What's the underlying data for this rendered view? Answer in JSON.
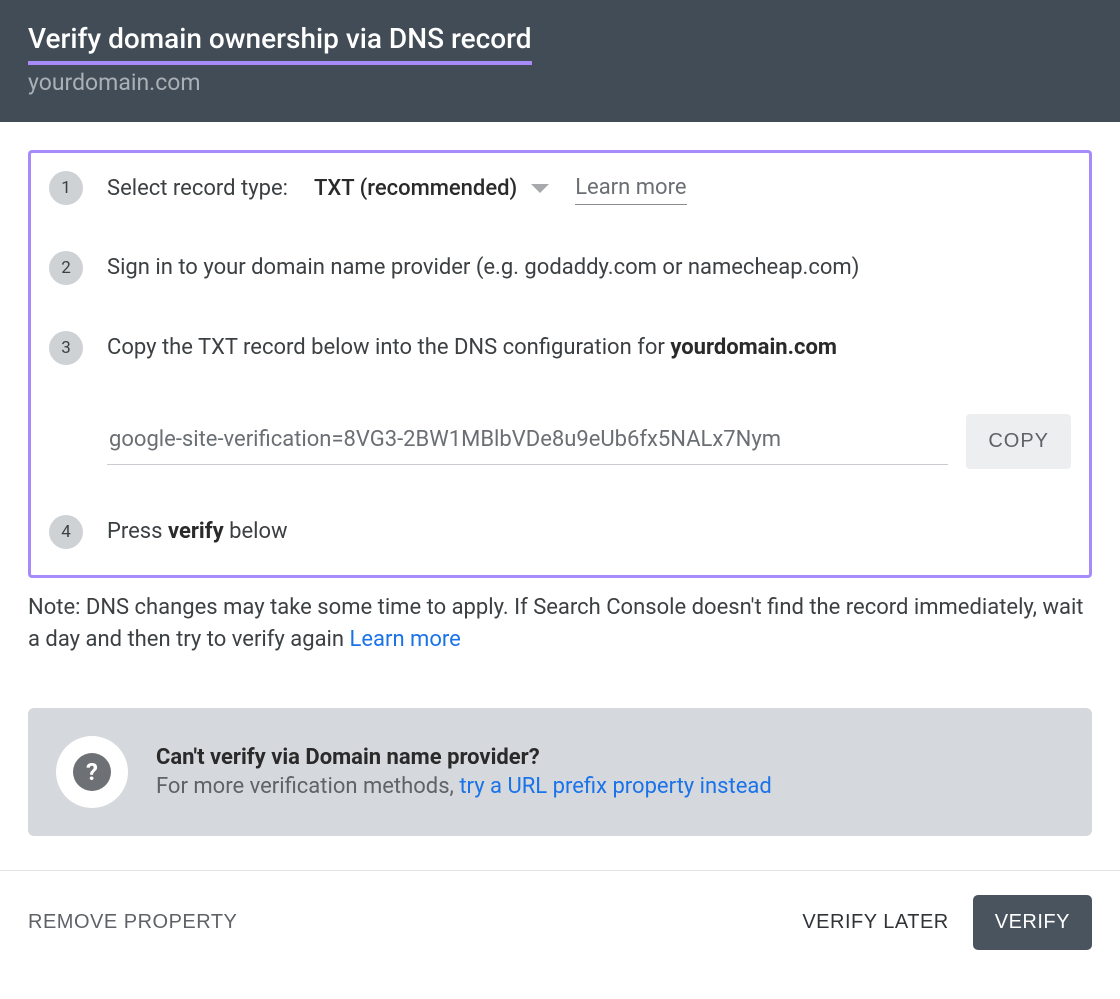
{
  "header": {
    "title": "Verify domain ownership via DNS record",
    "domain": "yourdomain.com"
  },
  "steps": {
    "n1": "1",
    "s1_label": "Select record type:",
    "s1_select_value": "TXT (recommended)",
    "s1_learn_more": "Learn more",
    "n2": "2",
    "s2_text": "Sign in to your domain name provider (e.g. godaddy.com or namecheap.com)",
    "n3": "3",
    "s3_prefix": "Copy the TXT record below into the DNS configuration for ",
    "s3_domain": "yourdomain.com",
    "s3_record": "google-site-verification=8VG3-2BW1MBlbVDe8u9eUb6fx5NALx7Nym",
    "s3_copy": "COPY",
    "n4": "4",
    "s4_prefix": "Press ",
    "s4_bold": "verify",
    "s4_suffix": " below"
  },
  "note": {
    "text": "Note: DNS changes may take some time to apply. If Search Console doesn't find the record immediately, wait a day and then try to verify again ",
    "link": "Learn more"
  },
  "alt": {
    "icon": "?",
    "title": "Can't verify via Domain name provider?",
    "sub_prefix": "For more verification methods, ",
    "sub_link": "try a URL prefix property instead"
  },
  "footer": {
    "remove": "REMOVE PROPERTY",
    "later": "VERIFY LATER",
    "verify": "VERIFY"
  }
}
